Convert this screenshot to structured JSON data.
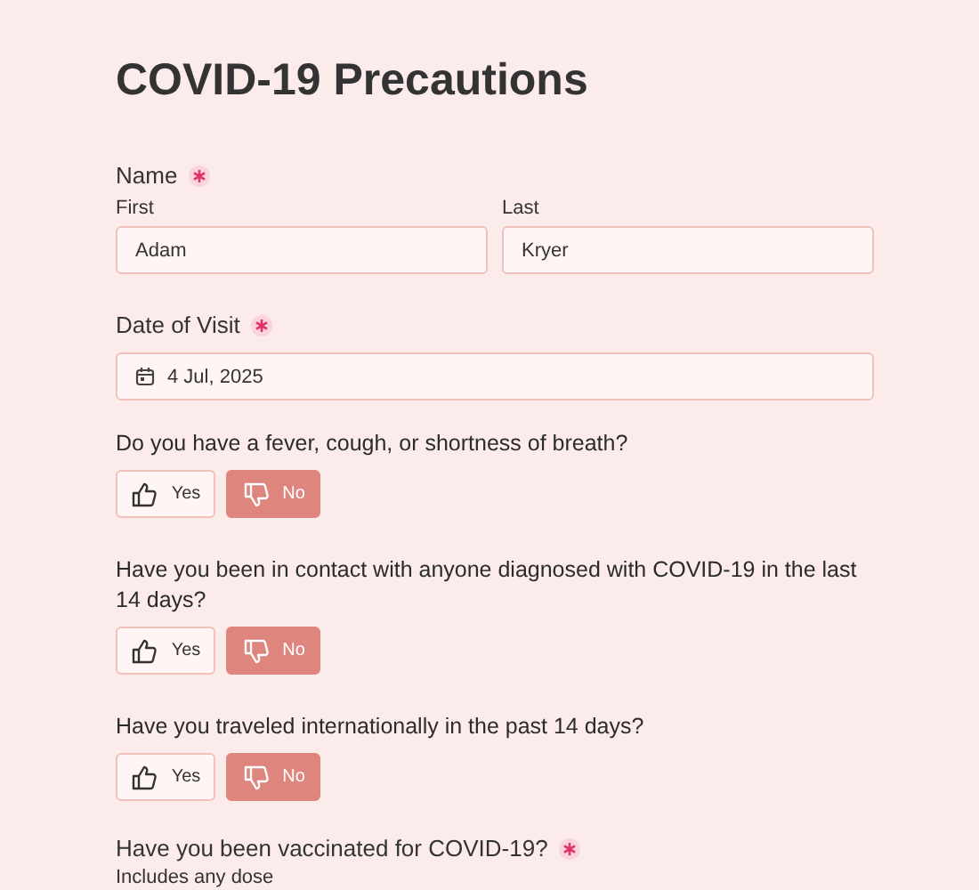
{
  "title": "COVID-19 Precautions",
  "name_field": {
    "label": "Name",
    "required": true,
    "parts": [
      {
        "label": "First",
        "value": "Adam"
      },
      {
        "label": "Last",
        "value": "Kryer"
      }
    ]
  },
  "date_field": {
    "label": "Date of Visit",
    "required": true,
    "value": "4 Jul, 2025"
  },
  "questions": [
    {
      "text": "Do you have a fever, cough, or shortness of breath?",
      "options": [
        {
          "label": "Yes",
          "kind": "up",
          "selected": false
        },
        {
          "label": "No",
          "kind": "down",
          "selected": true
        }
      ]
    },
    {
      "text": "Have you been in contact with anyone diagnosed with COVID-19 in the last 14 days?",
      "options": [
        {
          "label": "Yes",
          "kind": "up",
          "selected": false
        },
        {
          "label": "No",
          "kind": "down",
          "selected": true
        }
      ]
    },
    {
      "text": "Have you traveled internationally in the past 14 days?",
      "options": [
        {
          "label": "Yes",
          "kind": "up",
          "selected": false
        },
        {
          "label": "No",
          "kind": "down",
          "selected": true
        }
      ]
    }
  ],
  "vaccine": {
    "label": "Have you been vaccinated for COVID-19?",
    "required": true,
    "hint": "Includes any dose"
  }
}
